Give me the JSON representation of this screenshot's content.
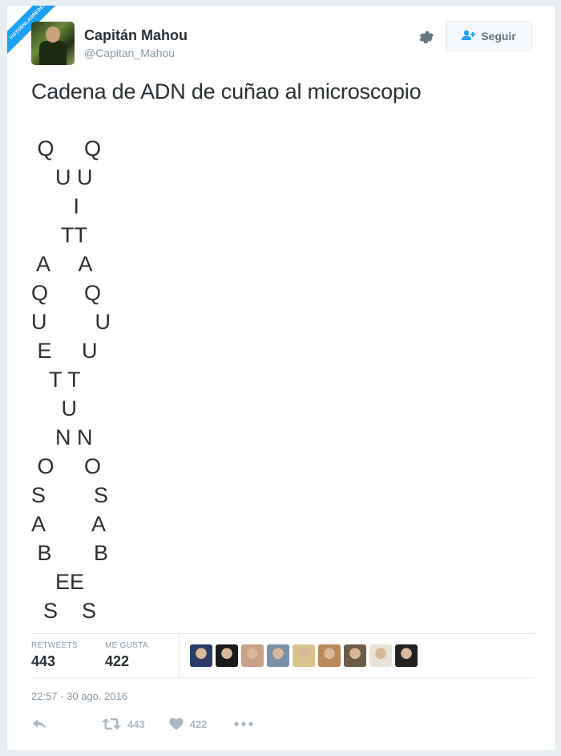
{
  "watermark": "VISTOENLASREDES",
  "user": {
    "name": "Capitán Mahou",
    "handle": "@Capitan_Mahou"
  },
  "follow_label": "Seguir",
  "tweet": {
    "text": "Cadena de ADN de cuñao al microscopio",
    "dna_lines": [
      " Q     Q",
      "    U U",
      "       I",
      "     TT",
      " A     A",
      "Q      Q",
      "U        U",
      " E     U",
      "   T T",
      "     U",
      "    N N",
      " O     O",
      "S        S",
      "A        A",
      " B       B",
      "    EE",
      "  S    S"
    ]
  },
  "stats": {
    "retweets_label": "RETWEETS",
    "retweets_value": "443",
    "likes_label": "ME GUSTA",
    "likes_value": "422"
  },
  "likers": [
    "#2b3a66",
    "#1a1a1a",
    "#c9a088",
    "#7a8fa8",
    "#d8c48a",
    "#b88a5a",
    "#6e5a48",
    "#e9e2d6",
    "#222222"
  ],
  "timestamp": "22:57 - 30 ago. 2016",
  "actions": {
    "retweet_count": "443",
    "like_count": "422"
  }
}
